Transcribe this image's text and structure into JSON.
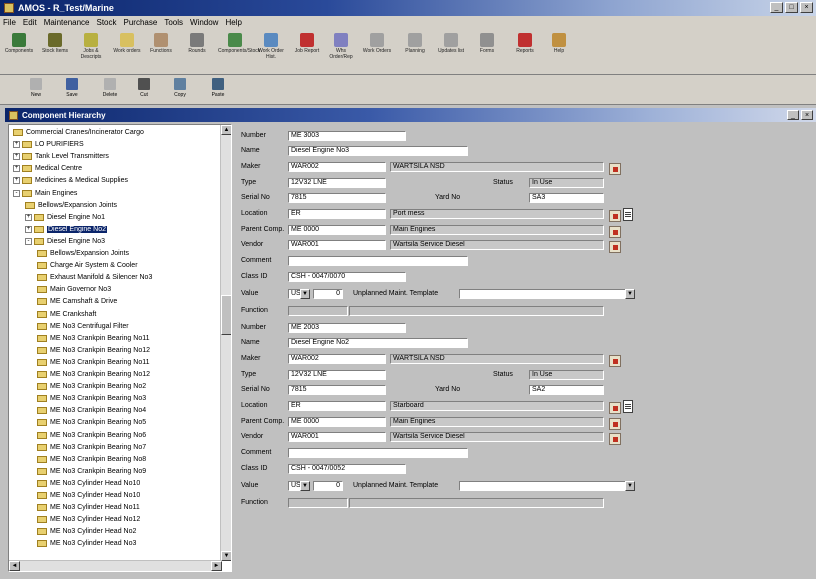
{
  "window": {
    "title": "AMOS - R_Test/Marine",
    "controls": [
      "_",
      "□",
      "×"
    ]
  },
  "menu": [
    "File",
    "Edit",
    "Maintenance",
    "Stock",
    "Purchase",
    "Tools",
    "Window",
    "Help"
  ],
  "toolbar": {
    "buttons": [
      {
        "label": "Components",
        "color": "#3a7a3a"
      },
      {
        "label": "Stock Items",
        "color": "#6a6a2a"
      },
      {
        "label": "Jobs & Descripts",
        "color": "#b8b040"
      },
      {
        "label": "Work orders",
        "color": "#d8c060"
      },
      {
        "label": "Functions",
        "color": "#b09070"
      },
      {
        "label": "Rounds",
        "color": "#7a7a7a"
      },
      {
        "label": "Components/Stock",
        "color": "#4a8a4a"
      },
      {
        "label": "Work Order Hist.",
        "color": "#5a8ac0"
      },
      {
        "label": "Job Report",
        "color": "#c03030"
      },
      {
        "label": "Whs Order/Rep",
        "color": "#8080c0"
      },
      {
        "label": "Work Orders",
        "color": "#a0a0a0"
      },
      {
        "label": "Planning",
        "color": "#a0a0a0"
      },
      {
        "label": "Updates list",
        "color": "#a0a0a0"
      },
      {
        "label": "Forms",
        "color": "#909090"
      },
      {
        "label": "Reports",
        "color": "#c03030"
      },
      {
        "label": "Help",
        "color": "#c09040"
      }
    ],
    "row2": [
      {
        "label": "New",
        "color": "#b0b0b0"
      },
      {
        "label": "Save",
        "color": "#4060a0"
      },
      {
        "label": "Delete",
        "color": "#b0b0b0"
      },
      {
        "label": "Cut",
        "color": "#505050"
      },
      {
        "label": "Copy",
        "color": "#6080a0"
      },
      {
        "label": "Paste",
        "color": "#406080"
      }
    ]
  },
  "child_window": {
    "title": "Component Hierarchy"
  },
  "tree": {
    "nodes": [
      {
        "label": "Commercial Cranes/Incinerator Cargo",
        "level": 1,
        "exp": "",
        "sel": false
      },
      {
        "label": "LO PURIFIERS",
        "level": 1,
        "exp": "+",
        "sel": false
      },
      {
        "label": "Tank Level Transmitters",
        "level": 1,
        "exp": "+",
        "sel": false
      },
      {
        "label": "Medical Centre",
        "level": 1,
        "exp": "+",
        "sel": false
      },
      {
        "label": "Medicines & Medical Supplies",
        "level": 1,
        "exp": "+",
        "sel": false
      },
      {
        "label": "Main Engines",
        "level": 1,
        "exp": "-",
        "sel": false
      },
      {
        "label": "Bellows/Expansion Joints",
        "level": 2,
        "exp": "",
        "sel": false
      },
      {
        "label": "Diesel Engine No1",
        "level": 2,
        "exp": "+",
        "sel": false
      },
      {
        "label": "Diesel Engine No2",
        "level": 2,
        "exp": "+",
        "sel": true
      },
      {
        "label": "Diesel Engine No3",
        "level": 2,
        "exp": "-",
        "sel": false
      },
      {
        "label": "Bellows/Expansion Joints",
        "level": 3,
        "exp": "",
        "sel": false
      },
      {
        "label": "Charge Air System & Cooler",
        "level": 3,
        "exp": "",
        "sel": false
      },
      {
        "label": "Exhaust Manifold & Silencer No3",
        "level": 3,
        "exp": "",
        "sel": false
      },
      {
        "label": "Main Governor No3",
        "level": 3,
        "exp": "",
        "sel": false
      },
      {
        "label": "ME Camshaft & Drive",
        "level": 3,
        "exp": "",
        "sel": false
      },
      {
        "label": "ME Crankshaft",
        "level": 3,
        "exp": "",
        "sel": false
      },
      {
        "label": "ME No3 Centrifugal Filter",
        "level": 3,
        "exp": "",
        "sel": false
      },
      {
        "label": "ME No3 Crankpin Bearing No11",
        "level": 3,
        "exp": "",
        "sel": false
      },
      {
        "label": "ME No3 Crankpin Bearing No12",
        "level": 3,
        "exp": "",
        "sel": false
      },
      {
        "label": "ME No3 Crankpin Bearing No11",
        "level": 3,
        "exp": "",
        "sel": false
      },
      {
        "label": "ME No3 Crankpin Bearing No12",
        "level": 3,
        "exp": "",
        "sel": false
      },
      {
        "label": "ME No3 Crankpin Bearing No2",
        "level": 3,
        "exp": "",
        "sel": false
      },
      {
        "label": "ME No3 Crankpin Bearing No3",
        "level": 3,
        "exp": "",
        "sel": false
      },
      {
        "label": "ME No3 Crankpin Bearing No4",
        "level": 3,
        "exp": "",
        "sel": false
      },
      {
        "label": "ME No3 Crankpin Bearing No5",
        "level": 3,
        "exp": "",
        "sel": false
      },
      {
        "label": "ME No3 Crankpin Bearing No6",
        "level": 3,
        "exp": "",
        "sel": false
      },
      {
        "label": "ME No3 Crankpin Bearing No7",
        "level": 3,
        "exp": "",
        "sel": false
      },
      {
        "label": "ME No3 Crankpin Bearing No8",
        "level": 3,
        "exp": "",
        "sel": false
      },
      {
        "label": "ME No3 Crankpin Bearing No9",
        "level": 3,
        "exp": "",
        "sel": false
      },
      {
        "label": "ME No3 Cylinder Head No10",
        "level": 3,
        "exp": "",
        "sel": false
      },
      {
        "label": "ME No3 Cylinder Head No10",
        "level": 3,
        "exp": "",
        "sel": false
      },
      {
        "label": "ME No3 Cylinder Head No11",
        "level": 3,
        "exp": "",
        "sel": false
      },
      {
        "label": "ME No3 Cylinder Head No12",
        "level": 3,
        "exp": "",
        "sel": false
      },
      {
        "label": "ME No3 Cylinder Head No2",
        "level": 3,
        "exp": "",
        "sel": false
      },
      {
        "label": "ME No3 Cylinder Head No3",
        "level": 3,
        "exp": "",
        "sel": false
      }
    ]
  },
  "labels": {
    "number": "Number",
    "name": "Name",
    "maker": "Maker",
    "type": "Type",
    "status": "Status",
    "serial": "Serial No",
    "yard": "Yard No",
    "location": "Location",
    "parent": "Parent Comp.",
    "vendor": "Vendor",
    "comment": "Comment",
    "class_id": "Class ID",
    "value": "Value",
    "unplanned": "Unplanned Maint. Template",
    "function": "Function"
  },
  "record1": {
    "number": "ME 3003",
    "name": "Diesel Engine No3",
    "maker_code": "WAR002",
    "maker_name": "WARTSILA NSD",
    "type": "12V32 LNE",
    "status": "In Use",
    "serial": "7815",
    "yard": "SA3",
    "location_code": "ER",
    "location_name": "Port mess",
    "parent_code": "ME 0000",
    "parent_name": "Main Engines",
    "vendor_code": "WAR001",
    "vendor_name": "Wartsila Service Diesel",
    "comment": "",
    "class_id": "CSH - 0047/0070",
    "currency": "USD",
    "value": "0",
    "unplanned": "",
    "function": ""
  },
  "record2": {
    "number": "ME 2003",
    "name": "Diesel Engine No2",
    "maker_code": "WAR002",
    "maker_name": "WARTSILA NSD",
    "type": "12V32 LNE",
    "status": "In Use",
    "serial": "7815",
    "yard": "SA2",
    "location_code": "ER",
    "location_name": "Starboard",
    "parent_code": "ME 0000",
    "parent_name": "Main Engines",
    "vendor_code": "WAR001",
    "vendor_name": "Wartsila Service Diesel",
    "comment": "",
    "class_id": "CSH - 0047/0052",
    "currency": "USD",
    "value": "0",
    "unplanned": "",
    "function": ""
  },
  "icons": {
    "dropdown": "▼",
    "up": "▲",
    "down": "▼",
    "left": "◄",
    "right": "►"
  }
}
